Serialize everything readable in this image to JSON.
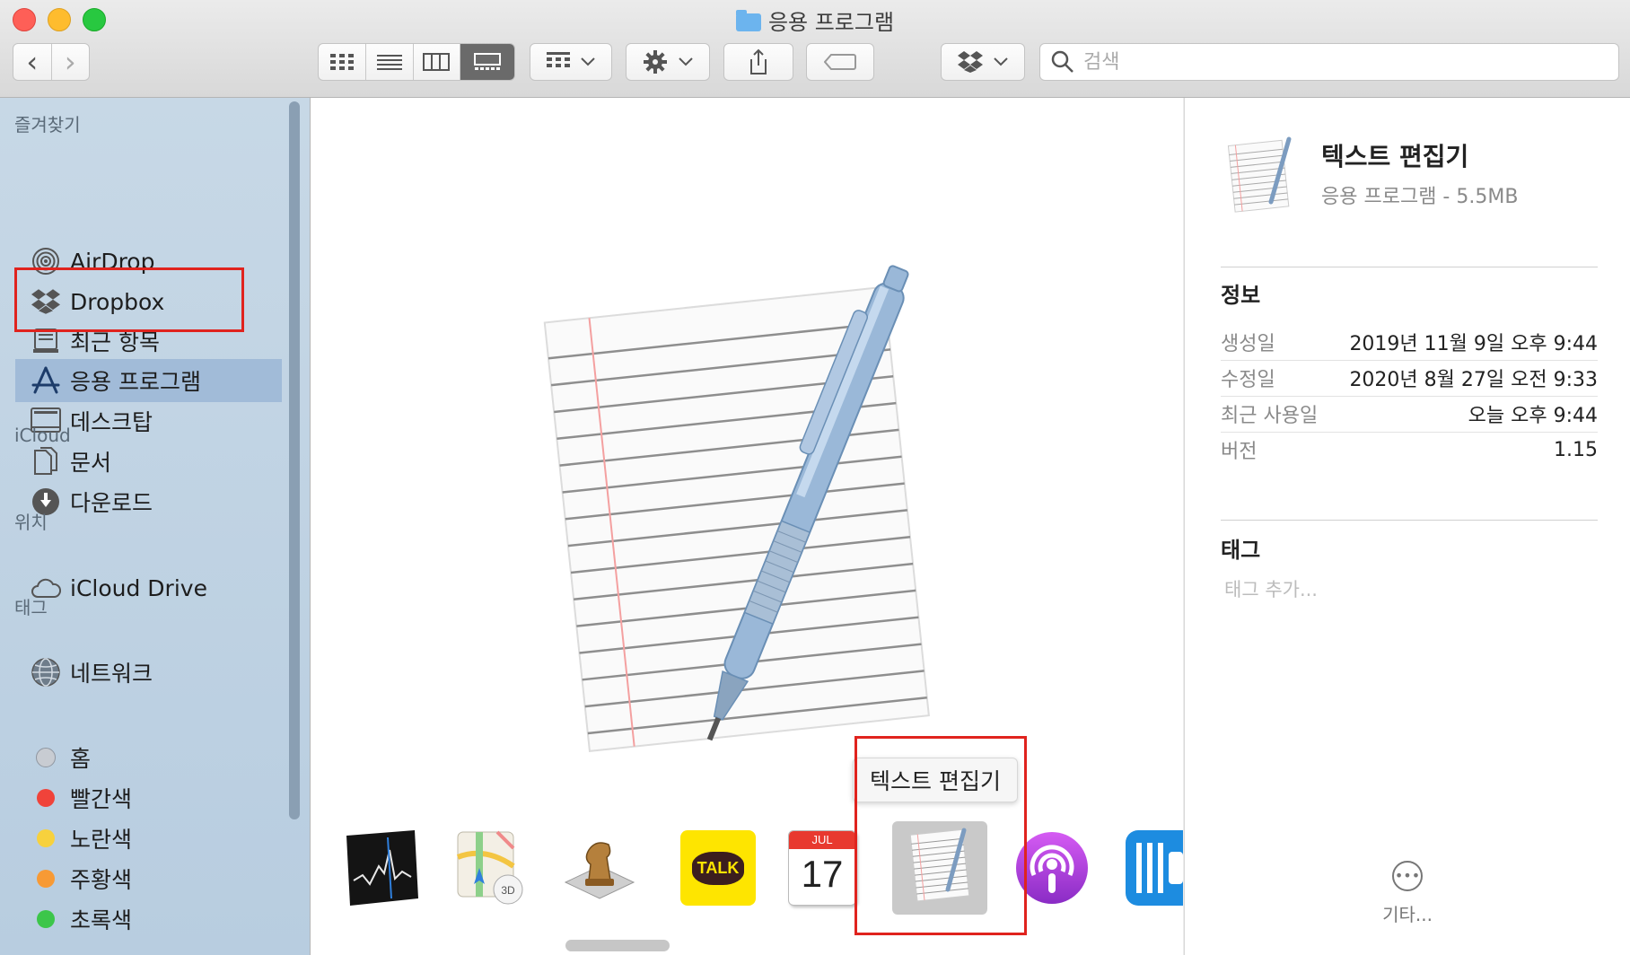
{
  "window": {
    "title": "응용 프로그램"
  },
  "toolbar": {
    "back": "‹",
    "forward": "›",
    "search_placeholder": "검색"
  },
  "sidebar": {
    "sections": {
      "favorites": "즐겨찾기",
      "icloud": "iCloud",
      "locations": "위치",
      "tags": "태그"
    },
    "favorites": [
      {
        "label": "AirDrop",
        "icon": "airdrop-icon"
      },
      {
        "label": "Dropbox",
        "icon": "dropbox-icon"
      },
      {
        "label": "최근 항목",
        "icon": "recents-icon"
      },
      {
        "label": "응용 프로그램",
        "icon": "applications-icon",
        "selected": true
      },
      {
        "label": "데스크탑",
        "icon": "desktop-icon"
      },
      {
        "label": "문서",
        "icon": "documents-icon"
      },
      {
        "label": "다운로드",
        "icon": "downloads-icon"
      }
    ],
    "icloud": [
      {
        "label": "iCloud Drive",
        "icon": "cloud-icon"
      }
    ],
    "locations": [
      {
        "label": "네트워크",
        "icon": "network-icon"
      }
    ],
    "tags": [
      {
        "label": "홈",
        "color": "#c8ccd2"
      },
      {
        "label": "빨간색",
        "color": "#f0433a"
      },
      {
        "label": "노란색",
        "color": "#f7d13d"
      },
      {
        "label": "주황색",
        "color": "#f79a35"
      },
      {
        "label": "초록색",
        "color": "#3cc64a"
      }
    ]
  },
  "gallery": {
    "tooltip": "텍스트 편집기",
    "calendar_month": "JUL",
    "calendar_day": "17",
    "kakao_label": "TALK",
    "maps_badge": "3D"
  },
  "inspector": {
    "name": "텍스트 편집기",
    "kind_size": "응용 프로그램 - 5.5MB",
    "info_heading": "정보",
    "info": [
      {
        "key": "생성일",
        "value": "2019년 11월 9일 오후 9:44"
      },
      {
        "key": "수정일",
        "value": "2020년 8월 27일 오전 9:33"
      },
      {
        "key": "최근 사용일",
        "value": "오늘 오후 9:44"
      },
      {
        "key": "버전",
        "value": "1.15"
      }
    ],
    "tags_heading": "태그",
    "tags_placeholder": "태그 추가...",
    "more_label": "기타..."
  },
  "colors": {
    "selection_highlight": "#e0231e",
    "sidebar_selected": "#a1bbd8"
  }
}
